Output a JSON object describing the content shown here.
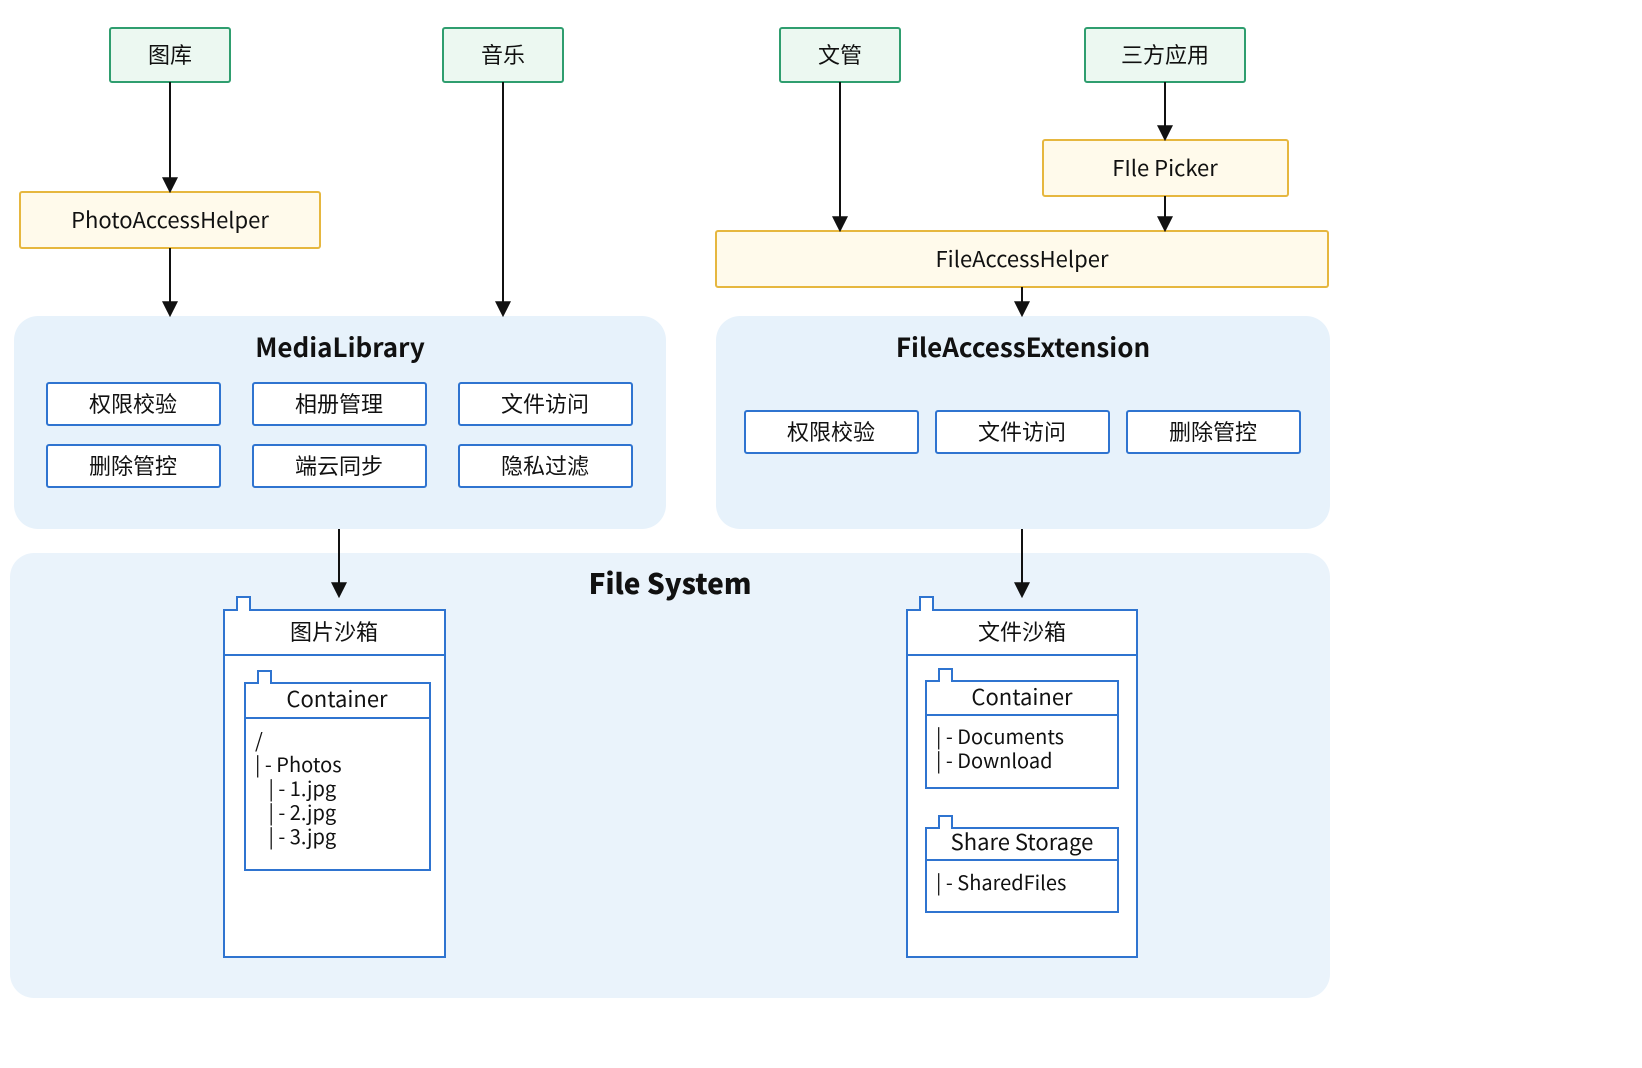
{
  "apps": {
    "gallery": "图库",
    "music": "音乐",
    "filemgr": "文管",
    "thirdparty": "三方应用"
  },
  "helpers": {
    "photo": "PhotoAccessHelper",
    "picker": "FIle Picker",
    "file": "FileAccessHelper"
  },
  "panels": {
    "media": {
      "title": "MediaLibrary",
      "items": {
        "perm": "权限校验",
        "album": "相册管理",
        "access": "文件访问",
        "delete": "删除管控",
        "sync": "端云同步",
        "privacy": "隐私过滤"
      }
    },
    "fae": {
      "title": "FileAccessExtension",
      "items": {
        "perm": "权限校验",
        "access": "文件访问",
        "delete": "删除管控"
      }
    }
  },
  "fs": {
    "title": "File System",
    "imgbox": {
      "title": "图片沙箱",
      "container": "Container",
      "lines": {
        "l0": "/",
        "l1": "| - Photos",
        "l2": "   | - 1.jpg",
        "l3": "   | - 2.jpg",
        "l4": "   | - 3.jpg"
      }
    },
    "filebox": {
      "title": "文件沙箱",
      "container": "Container",
      "cont_lines": {
        "l0": "| - Documents",
        "l1": "| - Download"
      },
      "share": "Share Storage",
      "share_lines": {
        "l0": "| - SharedFiles"
      }
    }
  }
}
